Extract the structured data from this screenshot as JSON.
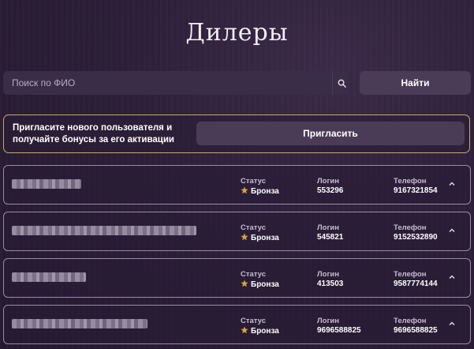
{
  "page": {
    "title": "Дилеры"
  },
  "search": {
    "placeholder": "Поиск по ФИО",
    "button_label": "Найти"
  },
  "invite": {
    "text_line1": "Пригласите нового пользователя и",
    "text_line2": "получайте бонусы за его активации",
    "button_label": "Пригласить"
  },
  "columns": {
    "status": "Статус",
    "login": "Логин",
    "phone": "Телефон"
  },
  "dealers": [
    {
      "status": "Бронза",
      "login": "553296",
      "phone": "9167321854"
    },
    {
      "status": "Бронза",
      "login": "545821",
      "phone": "9152532890"
    },
    {
      "status": "Бронза",
      "login": "413503",
      "phone": "9587774144"
    },
    {
      "status": "Бронза",
      "login": "9696588825",
      "phone": "9696588825"
    }
  ],
  "colors": {
    "accent_border": "#c9a96a",
    "button_bg": "#4a3c57",
    "background": "#2c1e38"
  }
}
